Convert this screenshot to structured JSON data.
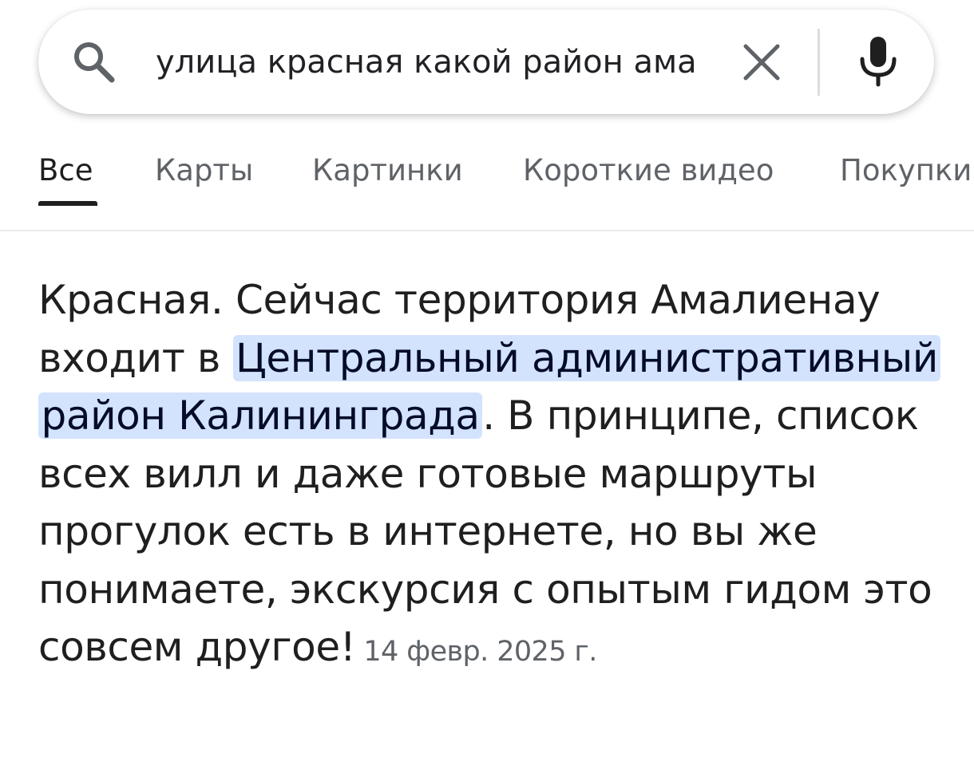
{
  "search": {
    "query": "улица красная какой район ама"
  },
  "tabs": [
    {
      "label": "Все",
      "active": true
    },
    {
      "label": "Карты",
      "active": false
    },
    {
      "label": "Картинки",
      "active": false
    },
    {
      "label": "Короткие видео",
      "active": false
    },
    {
      "label": "Покупки",
      "active": false
    }
  ],
  "snippet": {
    "text_before": "Красная. Сейчас территория Амалиенау входит в ",
    "highlight": "Центральный административный район Калининграда",
    "text_after": ". В принципе, список всех вилл и даже готовые маршруты прогулок есть в интернете, но вы же понимаете, экскурсия с опытым гидом это совсем другое!",
    "date": "14 февр. 2025 г."
  },
  "colors": {
    "highlight_bg": "#d3e3fd",
    "highlight_text": "#040c28",
    "muted_text": "#5f6368",
    "body_text": "#1f1f1f"
  },
  "icons": {
    "search": "search-icon",
    "clear": "close-icon",
    "voice": "microphone-icon"
  }
}
